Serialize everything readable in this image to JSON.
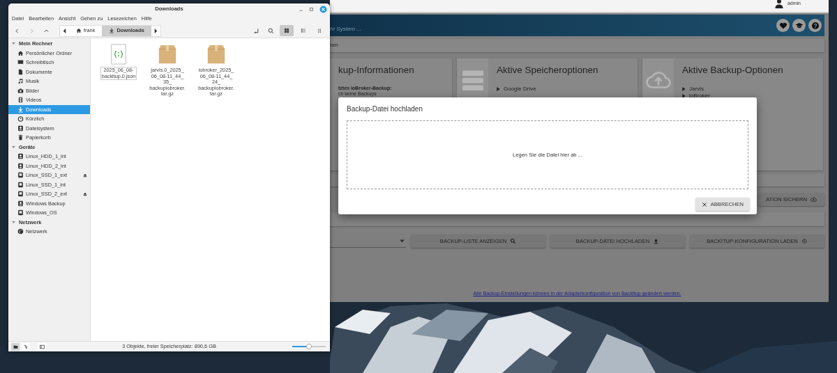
{
  "file_manager": {
    "title": "Downloads",
    "menu": [
      "Datei",
      "Bearbeiten",
      "Ansicht",
      "Gehen zu",
      "Lesezeichen",
      "Hilfe"
    ],
    "path": [
      {
        "label": "frank",
        "kind": "home",
        "selected": false
      },
      {
        "label": "Downloads",
        "kind": "download",
        "selected": true
      }
    ],
    "view_modes": [
      {
        "kind": "icons",
        "selected": true
      },
      {
        "kind": "list",
        "selected": false
      },
      {
        "kind": "compact",
        "selected": false
      }
    ],
    "sidebar": [
      {
        "heading": "Mein Rechner",
        "expanded": true,
        "items": [
          {
            "label": "Persönlicher Ordner",
            "kind": "home",
            "selected": false,
            "eject": false
          },
          {
            "label": "Schreibtisch",
            "kind": "desktop",
            "selected": false,
            "eject": false
          },
          {
            "label": "Dokumente",
            "kind": "document",
            "selected": false,
            "eject": false
          },
          {
            "label": "Musik",
            "kind": "music",
            "selected": false,
            "eject": false
          },
          {
            "label": "Bilder",
            "kind": "camera",
            "selected": false,
            "eject": false
          },
          {
            "label": "Videos",
            "kind": "film",
            "selected": false,
            "eject": false
          },
          {
            "label": "Downloads",
            "kind": "download",
            "selected": true,
            "eject": false
          },
          {
            "label": "Kürzlich",
            "kind": "clock",
            "selected": false,
            "eject": false
          },
          {
            "label": "Dateisystem",
            "kind": "drive",
            "selected": false,
            "eject": false
          },
          {
            "label": "Papierkorb",
            "kind": "trash",
            "selected": false,
            "eject": false
          }
        ]
      },
      {
        "heading": "Geräte",
        "expanded": true,
        "items": [
          {
            "label": "Linux_HDD_1_int",
            "kind": "drive",
            "selected": false,
            "eject": false
          },
          {
            "label": "Linux_HDD_2_int",
            "kind": "drive",
            "selected": false,
            "eject": false
          },
          {
            "label": "Linux_SSD_1_ext",
            "kind": "ssd",
            "selected": false,
            "eject": true
          },
          {
            "label": "Linux_SSD_1_int",
            "kind": "ssd",
            "selected": false,
            "eject": false
          },
          {
            "label": "Linux_SSD_2_ext",
            "kind": "ssd",
            "selected": false,
            "eject": true
          },
          {
            "label": "Windows Backup",
            "kind": "drive",
            "selected": false,
            "eject": false
          },
          {
            "label": "Windows_OS",
            "kind": "ssd",
            "selected": false,
            "eject": false
          }
        ]
      },
      {
        "heading": "Netzwerk",
        "expanded": true,
        "items": [
          {
            "label": "Netzwerk",
            "kind": "globe",
            "selected": false,
            "eject": false
          }
        ]
      }
    ],
    "files": [
      {
        "name_lines": [
          "2025_06_08-",
          "backitup.0.json"
        ],
        "kind": "json",
        "selected": true
      },
      {
        "name_lines": [
          "jarvis.0_2025_",
          "06_08-11_44_",
          "35_",
          "backupiobroker.",
          "tar.gz"
        ],
        "kind": "archive",
        "selected": false
      },
      {
        "name_lines": [
          "iobroker_2025_",
          "06_08-11_44_",
          "24_",
          "backupiobroker.",
          "tar.gz"
        ],
        "kind": "archive",
        "selected": false
      }
    ],
    "side_panes": [
      {
        "kind": "places",
        "selected": true
      },
      {
        "kind": "tree",
        "selected": false
      }
    ],
    "status": "3 Objekte, freier Speicherplatz: 890,6 GB",
    "zoom": {
      "level": 0.5
    }
  },
  "browser": {
    "user": "admin",
    "subtitle": "hr System ...",
    "breadcrumb": "nen",
    "cards": [
      {
        "title": "kup-Informationen",
        "lines": [
          {
            "text": "tztes ioBroker-Backup:",
            "bold": true
          },
          {
            "text": "ch keine Backups",
            "bold": false
          }
        ]
      },
      {
        "title": "Aktive Speicheroptionen",
        "bullets": [
          "Google Drive"
        ]
      },
      {
        "title": "Aktive Backup-Optionen",
        "bullets": [
          "Jarvis",
          "ioBroker"
        ]
      }
    ],
    "save_button": {
      "label": "ATION SICHERN"
    },
    "actions": [
      {
        "label": "BACKUP-LISTE ANZEIGEN"
      },
      {
        "label": "BACKUP-DATEI HOCHLADEN"
      },
      {
        "label": "BACKITUP-KONFIGURATION LADEN"
      }
    ],
    "footer_link": "Alle Backup-Einstellungen können in der Adapterkonfiguration von Backitup geändert werden.",
    "dialog": {
      "title": "Backup-Datei hochladen",
      "drop_text": "Legen Sie die Datei hier ab ...",
      "cancel": "ABBRECHEN"
    }
  }
}
